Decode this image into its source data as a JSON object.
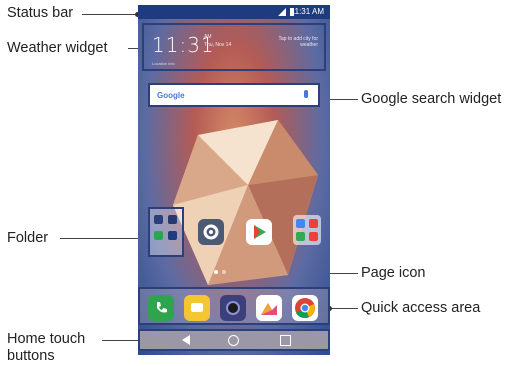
{
  "labels": {
    "status_bar": "Status bar",
    "weather_widget": "Weather widget",
    "google_search_widget": "Google search widget",
    "folder": "Folder",
    "page_icon": "Page icon",
    "quick_access_area": "Quick access area",
    "home_touch_buttons_line1": "Home touch",
    "home_touch_buttons_line2": "buttons"
  },
  "phone": {
    "status_time": "11:31 AM",
    "weather": {
      "time": "11:31",
      "ampm": "AM",
      "date": "Thu, Nov 14",
      "tap_text": "Tap to add city for weather",
      "location": "Location info"
    },
    "search": {
      "brand": "Google"
    },
    "colors": {
      "statusbar": "#1f3b80",
      "outline": "#2b3f7b",
      "navbar": "#9a98a7"
    }
  }
}
